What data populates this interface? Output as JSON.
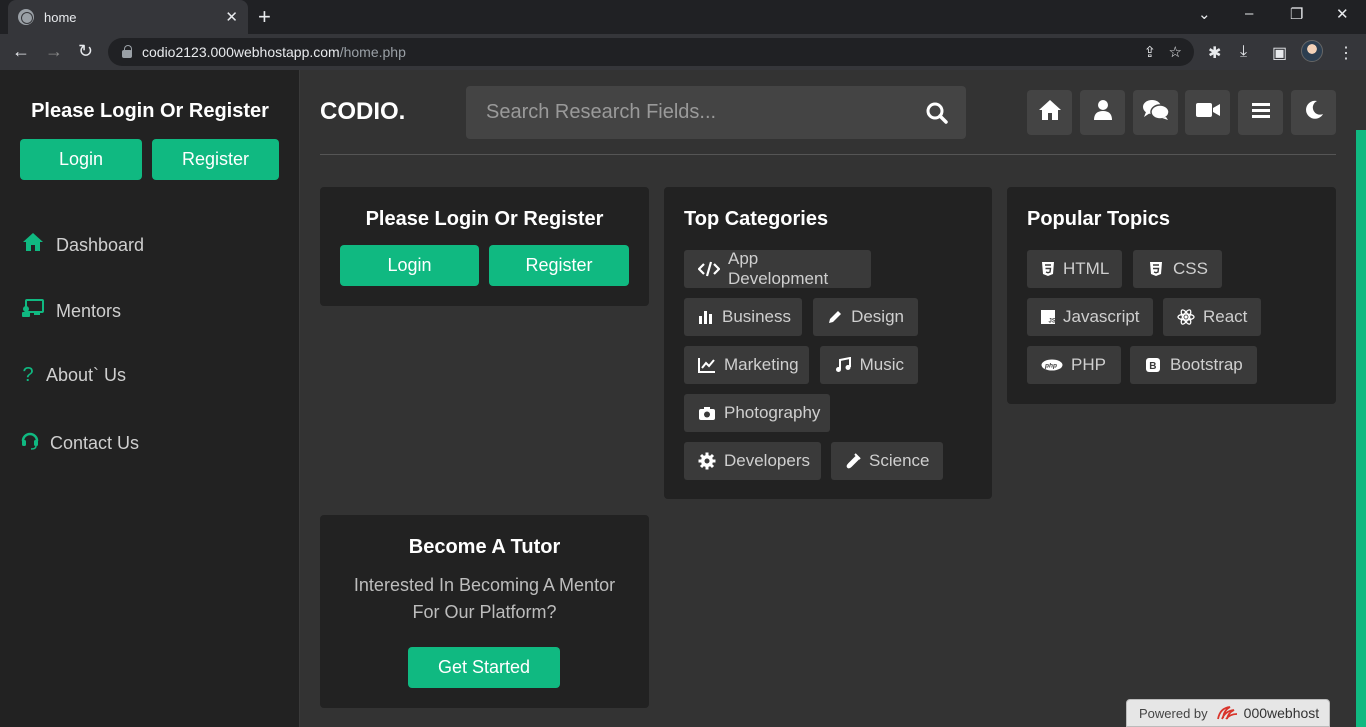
{
  "browser": {
    "tab_title": "home",
    "tab_close": "✕",
    "new_tab": "+",
    "url_host": "codio2123.000webhostapp.com",
    "url_path": "/home.php"
  },
  "sidebar": {
    "title": "Please Login Or Register",
    "login_label": "Login",
    "register_label": "Register",
    "items": [
      {
        "label": "Dashboard",
        "icon": "home-icon"
      },
      {
        "label": "Mentors",
        "icon": "chalkboard-icon"
      },
      {
        "label": "About` Us",
        "icon": "question-icon"
      },
      {
        "label": "Contact Us",
        "icon": "headset-icon"
      }
    ]
  },
  "header": {
    "brand": "CODIO.",
    "search_placeholder": "Search Research Fields...",
    "buttons": [
      "home-icon",
      "user-icon",
      "comments-icon",
      "video-icon",
      "menu-icon",
      "moon-icon"
    ]
  },
  "login_card": {
    "title": "Please Login Or Register",
    "login_label": "Login",
    "register_label": "Register"
  },
  "categories": {
    "title": "Top Categories",
    "items": [
      {
        "label": "App Development",
        "icon": "code-icon"
      },
      {
        "label": "Business",
        "icon": "chart-bar-icon"
      },
      {
        "label": "Design",
        "icon": "pencil-icon"
      },
      {
        "label": "Marketing",
        "icon": "chart-line-icon"
      },
      {
        "label": "Music",
        "icon": "music-icon"
      },
      {
        "label": "Photography",
        "icon": "camera-icon"
      },
      {
        "label": "Developers",
        "icon": "cog-icon"
      },
      {
        "label": "Science",
        "icon": "vial-icon"
      }
    ]
  },
  "topics": {
    "title": "Popular Topics",
    "items": [
      {
        "label": "HTML",
        "icon": "html5-icon"
      },
      {
        "label": "CSS",
        "icon": "css3-icon"
      },
      {
        "label": "Javascript",
        "icon": "js-icon"
      },
      {
        "label": "React",
        "icon": "react-icon"
      },
      {
        "label": "PHP",
        "icon": "php-icon"
      },
      {
        "label": "Bootstrap",
        "icon": "bootstrap-icon"
      }
    ]
  },
  "tutor": {
    "title": "Become A Tutor",
    "text_line1": "Interested In Becoming A Mentor",
    "text_line2": "For Our Platform?",
    "button_label": "Get Started"
  },
  "footer_badge": {
    "powered_by": "Powered by",
    "brand": "000webhost"
  },
  "colors": {
    "accent": "#10b981",
    "sidebar_bg": "#222222",
    "page_bg": "#333333"
  }
}
